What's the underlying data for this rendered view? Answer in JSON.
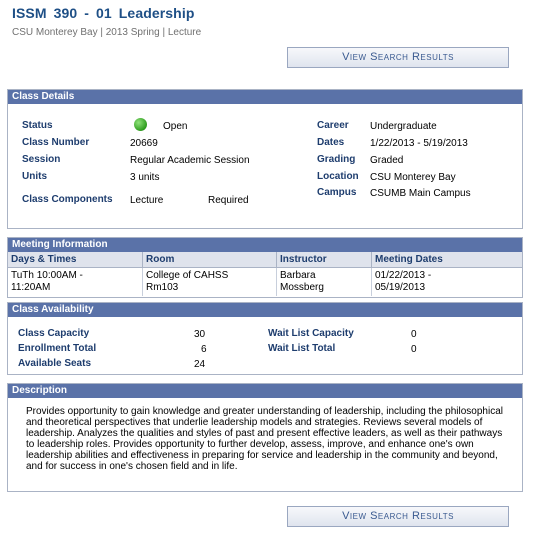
{
  "header": {
    "title": "ISSM  390 - 01   Leadership",
    "subtitle": "CSU Monterey Bay | 2013 Spring | Lecture"
  },
  "buttons": {
    "view_search_results": "View Search Results"
  },
  "class_details": {
    "heading": "Class Details",
    "status_label": "Status",
    "status_value": "Open",
    "class_number_label": "Class Number",
    "class_number_value": "20669",
    "session_label": "Session",
    "session_value": "Regular Academic Session",
    "units_label": "Units",
    "units_value": "3 units",
    "components_label": "Class Components",
    "components_value": "Lecture",
    "components_req": "Required",
    "career_label": "Career",
    "career_value": "Undergraduate",
    "dates_label": "Dates",
    "dates_value": "1/22/2013 - 5/19/2013",
    "grading_label": "Grading",
    "grading_value": "Graded",
    "location_label": "Location",
    "location_value": "CSU Monterey Bay",
    "campus_label": "Campus",
    "campus_value": "CSUMB Main Campus",
    "status_color": "#2e9c1e"
  },
  "meeting_info": {
    "heading": "Meeting Information",
    "columns": [
      "Days & Times",
      "Room",
      "Instructor",
      "Meeting Dates"
    ],
    "row": {
      "days_line1": "TuTh 10:00AM -",
      "days_line2": "11:20AM",
      "room_line1": "College of CAHSS",
      "room_line2": "Rm103",
      "instructor_line1": "Barbara",
      "instructor_line2": "Mossberg",
      "dates_line1": "01/22/2013 -",
      "dates_line2": "05/19/2013"
    }
  },
  "availability": {
    "heading": "Class Availability",
    "capacity_label": "Class Capacity",
    "capacity_value": "30",
    "enrollment_label": "Enrollment Total",
    "enrollment_value": "6",
    "seats_label": "Available Seats",
    "seats_value": "24",
    "wl_capacity_label": "Wait List Capacity",
    "wl_capacity_value": "0",
    "wl_total_label": "Wait List Total",
    "wl_total_value": "0"
  },
  "description": {
    "heading": "Description",
    "text": "Provides opportunity to gain knowledge and greater understanding of leadership, including the philosophical and theoretical perspectives that underlie leadership models and strategies. Reviews several models of leadership. Analyzes the qualities and styles of past and present effective leaders, as well as their pathways to leadership roles. Provides opportunity to further develop, assess, improve, and enhance one's own leadership abilities and effectiveness in preparing for service and leadership in the community and beyond, and for success in one's chosen field and in life."
  },
  "colors": {
    "section_header": "#5a72a8",
    "title": "#1e4f86",
    "label": "#1e3d6e"
  }
}
